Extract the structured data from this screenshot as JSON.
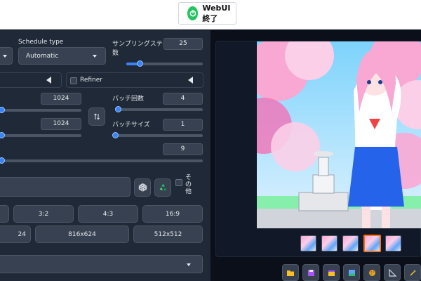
{
  "top": {
    "webui_button": "WebUI終了"
  },
  "schedule": {
    "label": "Schedule type",
    "value": "Automatic"
  },
  "steps": {
    "label_line1": "サンプリングステップ",
    "label_line2": "数",
    "value": "25",
    "fraction": 0.17
  },
  "refiner": {
    "label": "Refiner"
  },
  "width": {
    "value": "1024",
    "fraction": 0.0
  },
  "height": {
    "value": "1024",
    "fraction": 0.0
  },
  "batch_count": {
    "label": "バッチ回数",
    "value": "4",
    "fraction": 0.03
  },
  "batch_size": {
    "label": "バッチサイズ",
    "value": "1",
    "fraction": 0.0
  },
  "cfg": {
    "value": "9",
    "fraction": 0.0
  },
  "seed_extra": {
    "label_line1": "そ",
    "label_line2": "の",
    "label_line3": "他"
  },
  "aspect_buttons": [
    "3:2",
    "4:3",
    "16:9"
  ],
  "size_buttons": [
    "24",
    "816x624",
    "512x512"
  ],
  "colors": {
    "accent": "#3b82f6",
    "panel": "#1f2937",
    "background": "#0b0f19"
  }
}
